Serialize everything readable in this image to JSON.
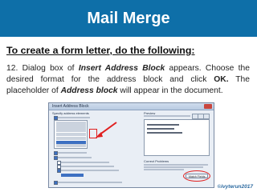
{
  "header": {
    "title": "Mail Merge"
  },
  "heading": "To create a form letter, do the following:",
  "step": {
    "number": "12.",
    "t1": "Dialog box of ",
    "t2": "Insert Address Block",
    "t3": " appears. Choose the desired format for the address block and click ",
    "t4": "OK.",
    "t5": " The placeholder of ",
    "t6": "Address block",
    "t7": " will appear in the document."
  },
  "dialog": {
    "title": "Insert Address Block",
    "left_pane_label": "Specify address elements",
    "right_pane_label": "Preview",
    "correct_problems_label": "Correct Problems",
    "match_fields_label": "Match Fields..."
  },
  "credit": "©ivyterun2017",
  "colors": {
    "banner": "#0e6fa8",
    "highlight": "#e02020"
  }
}
